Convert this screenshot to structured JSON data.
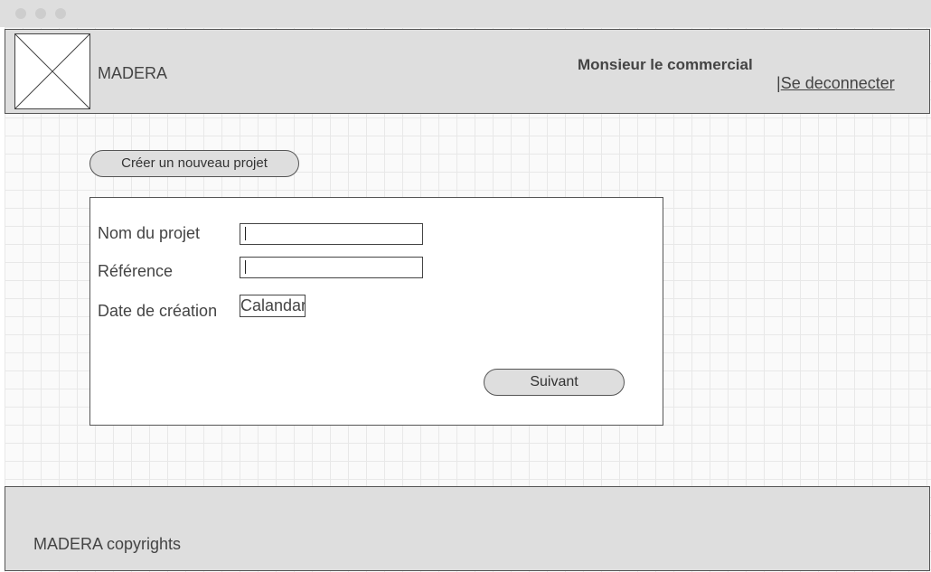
{
  "window": {
    "controls": [
      "close",
      "minimize",
      "maximize"
    ]
  },
  "header": {
    "logo_icon": "image-placeholder-icon",
    "brand": "MADERA",
    "user_name": "Monsieur le commercial",
    "logout_separator": "|",
    "logout_label": "Se deconnecter"
  },
  "actions": {
    "new_project_label": "Créer un nouveau projet"
  },
  "form": {
    "project_name_label": "Nom du projet",
    "project_name_value": "",
    "reference_label": "Référence",
    "reference_value": "",
    "creation_date_label": "Date de création",
    "calendar_label": "Calandar",
    "next_label": "Suivant"
  },
  "footer": {
    "copyright": "MADERA copyrights"
  },
  "colors": {
    "chrome": "#dedede",
    "border": "#555555",
    "text": "#444444",
    "grid": "#e8e8e8"
  }
}
